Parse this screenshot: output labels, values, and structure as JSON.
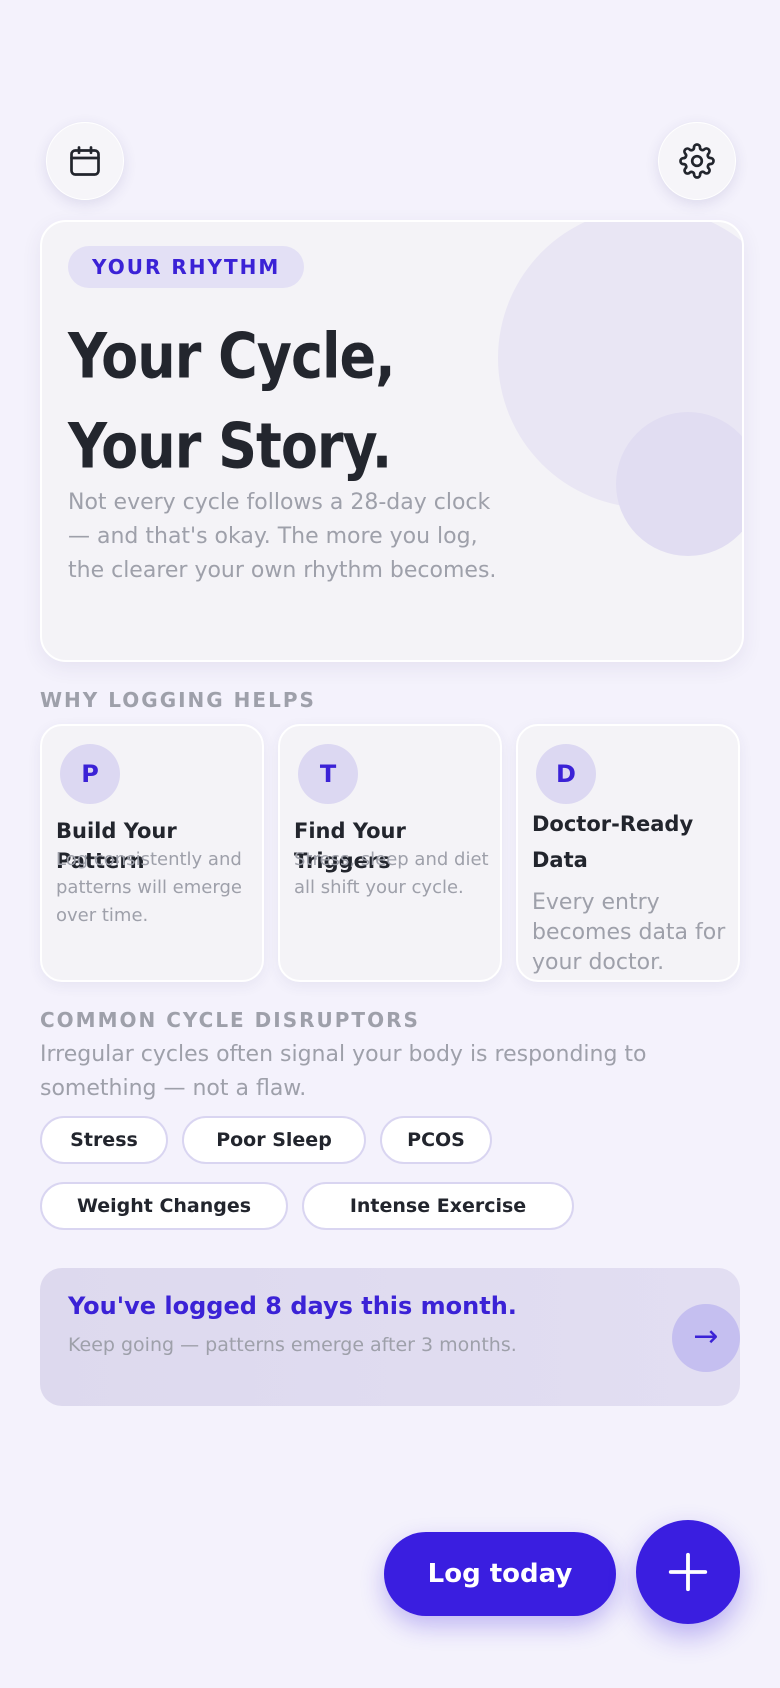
{
  "header": {
    "calendar_icon": "calendar-icon",
    "settings_icon": "gear-icon"
  },
  "hero": {
    "tag": "YOUR RHYTHM",
    "title_line1": "Your Cycle,",
    "title_line2": "Your Story.",
    "body": "Not every cycle follows a 28-day clock — and that's okay. The more you log, the clearer your own rhythm becomes."
  },
  "why_logging": {
    "label": "WHY LOGGING HELPS",
    "cards": [
      {
        "letter": "P",
        "title": "Build Your Pattern",
        "body": "Log consistently and patterns will emerge over time."
      },
      {
        "letter": "T",
        "title": "Find Your Triggers",
        "body": "Stress, sleep and diet all shift your cycle."
      },
      {
        "letter": "D",
        "title": "Doctor-Ready Data",
        "body": "Every entry becomes data for your doctor."
      }
    ]
  },
  "disruptors": {
    "label": "COMMON CYCLE DISRUPTORS",
    "description": "Irregular cycles often signal your body is responding to something — not a flaw.",
    "chips": [
      "Stress",
      "Poor Sleep",
      "PCOS",
      "Weight Changes",
      "Intense Exercise"
    ]
  },
  "progress": {
    "headline": "You've logged 8 days this month.",
    "subtext": "Keep going — patterns emerge after 3 months.",
    "arrow": "→"
  },
  "actions": {
    "log_label": "Log today",
    "add_icon": "plus-icon"
  },
  "colors": {
    "accent": "#3a1ee0",
    "background": "#f4f2fc",
    "muted_text": "#9ea0aa"
  }
}
